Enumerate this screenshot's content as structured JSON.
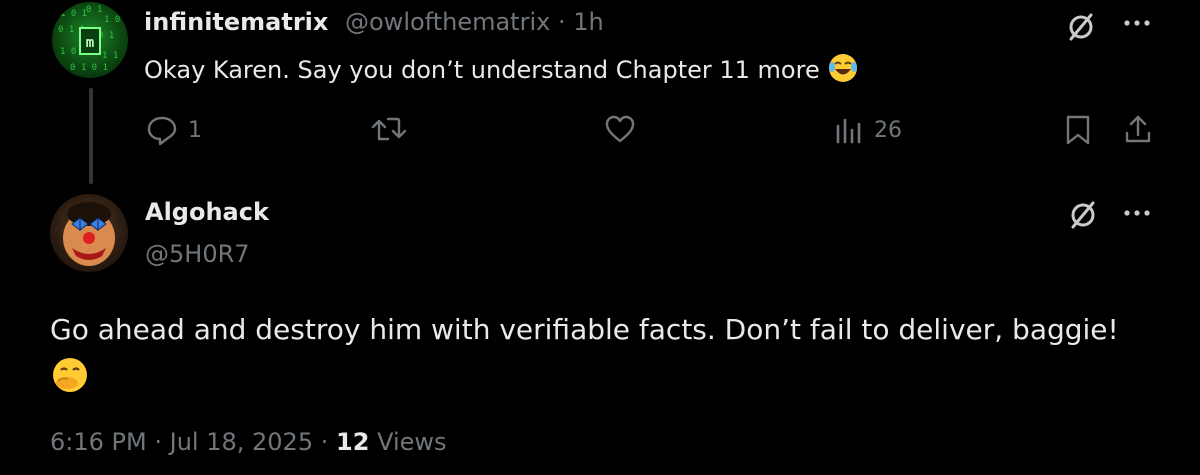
{
  "reply": {
    "author_name": "infinitematrix",
    "author_handle": "@owlofthematrix",
    "separator": "·",
    "time": "1h",
    "text": "Okay Karen. Say you don’t understand Chapter 11 more",
    "emoji": "😂",
    "reply_count": "1",
    "views": "26",
    "avatar_icon": "matrix-code-avatar",
    "menu_icon": "more-dots-icon",
    "grok_icon": "grok-slash-icon"
  },
  "tweet": {
    "author_name": "Algohack",
    "author_handle": "@5H0R7",
    "text": "Go ahead and destroy him with verifiable facts. Don’t fail to deliver, baggie!",
    "emoji": "🤭",
    "time": "6:16 PM",
    "separator": "·",
    "date": "Jul 18, 2025",
    "views_count": "12",
    "views_label": "Views",
    "avatar_icon": "clown-face-avatar"
  },
  "colors": {
    "background": "#000000",
    "primary_text": "#e7e9ea",
    "secondary_text": "#71767b",
    "thread_line": "#333639"
  }
}
